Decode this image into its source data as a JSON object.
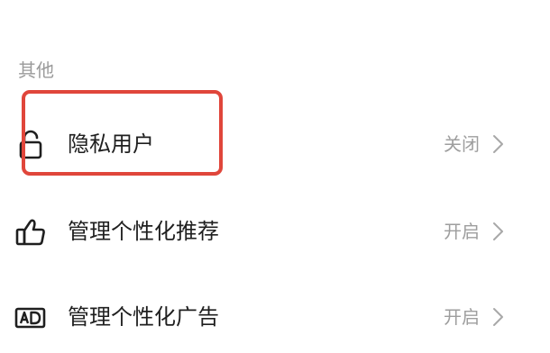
{
  "section": {
    "title": "其他"
  },
  "rows": [
    {
      "icon": "lock-icon",
      "label": "隐私用户",
      "value": "关闭"
    },
    {
      "icon": "thumbs-up-icon",
      "label": "管理个性化推荐",
      "value": "开启"
    },
    {
      "icon": "ad-icon",
      "label": "管理个性化广告",
      "value": "开启"
    }
  ],
  "colors": {
    "highlight": "#e0463b",
    "secondary_text": "#9e9e9e"
  }
}
